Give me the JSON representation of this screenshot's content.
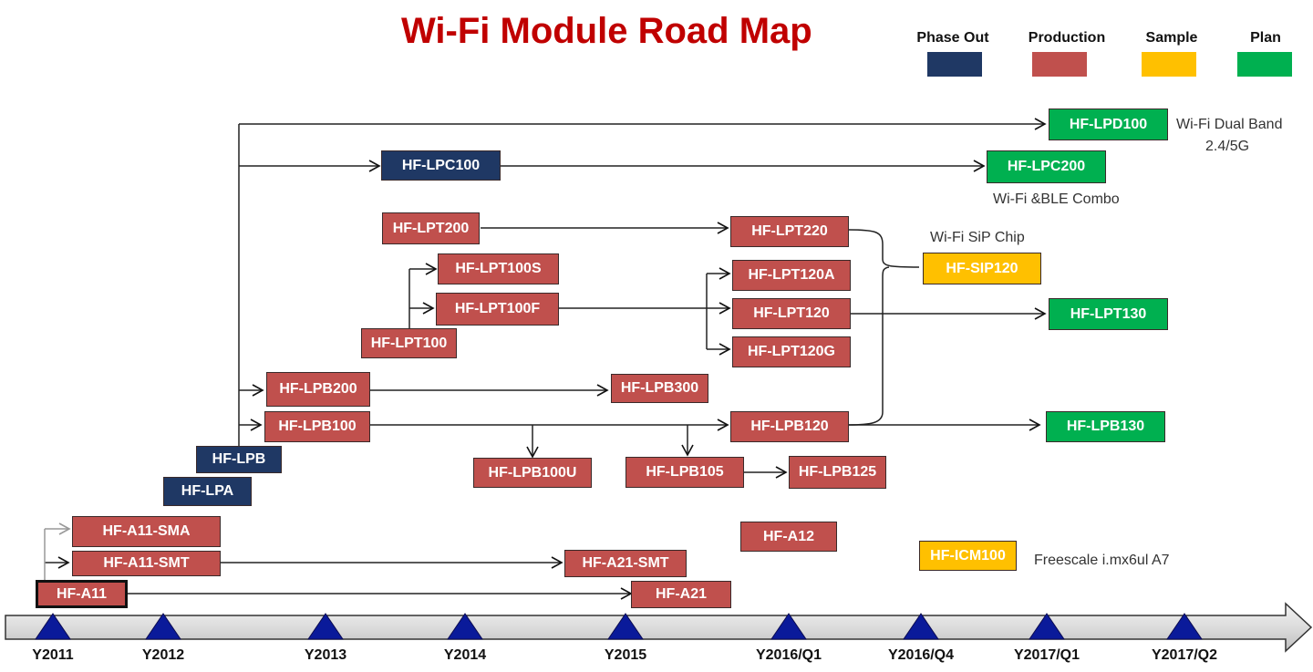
{
  "title": "Wi-Fi Module Road Map",
  "legend": [
    {
      "key": "phase_out",
      "label": "Phase Out",
      "color": "#1f3864"
    },
    {
      "key": "production",
      "label": "Production",
      "color": "#c0504d"
    },
    {
      "key": "sample",
      "label": "Sample",
      "color": "#ffc000"
    },
    {
      "key": "plan",
      "label": "Plan",
      "color": "#00b050"
    }
  ],
  "modules": [
    {
      "id": "lpd100",
      "label": "HF-LPD100",
      "status": "plan"
    },
    {
      "id": "lpc100",
      "label": "HF-LPC100",
      "status": "phase_out"
    },
    {
      "id": "lpc200",
      "label": "HF-LPC200",
      "status": "plan"
    },
    {
      "id": "lpt200",
      "label": "HF-LPT200",
      "status": "production"
    },
    {
      "id": "lpt220",
      "label": "HF-LPT220",
      "status": "production"
    },
    {
      "id": "sip120",
      "label": "HF-SIP120",
      "status": "sample"
    },
    {
      "id": "lpt100s",
      "label": "HF-LPT100S",
      "status": "production"
    },
    {
      "id": "lpt120a",
      "label": "HF-LPT120A",
      "status": "production"
    },
    {
      "id": "lpt100f",
      "label": "HF-LPT100F",
      "status": "production"
    },
    {
      "id": "lpt120",
      "label": "HF-LPT120",
      "status": "production"
    },
    {
      "id": "lpt130",
      "label": "HF-LPT130",
      "status": "plan"
    },
    {
      "id": "lpt100",
      "label": "HF-LPT100",
      "status": "production"
    },
    {
      "id": "lpt120g",
      "label": "HF-LPT120G",
      "status": "production"
    },
    {
      "id": "lpb200",
      "label": "HF-LPB200",
      "status": "production"
    },
    {
      "id": "lpb300",
      "label": "HF-LPB300",
      "status": "production"
    },
    {
      "id": "lpb100",
      "label": "HF-LPB100",
      "status": "production"
    },
    {
      "id": "lpb120",
      "label": "HF-LPB120",
      "status": "production"
    },
    {
      "id": "lpb130",
      "label": "HF-LPB130",
      "status": "plan"
    },
    {
      "id": "lpb",
      "label": "HF-LPB",
      "status": "phase_out"
    },
    {
      "id": "lpb100u",
      "label": "HF-LPB100U",
      "status": "production"
    },
    {
      "id": "lpb105",
      "label": "HF-LPB105",
      "status": "production"
    },
    {
      "id": "lpb125",
      "label": "HF-LPB125",
      "status": "production"
    },
    {
      "id": "lpa",
      "label": "HF-LPA",
      "status": "phase_out"
    },
    {
      "id": "a11sma",
      "label": "HF-A11-SMA",
      "status": "production"
    },
    {
      "id": "a12",
      "label": "HF-A12",
      "status": "production"
    },
    {
      "id": "a11smt",
      "label": "HF-A11-SMT",
      "status": "production"
    },
    {
      "id": "a21smt",
      "label": "HF-A21-SMT",
      "status": "production"
    },
    {
      "id": "icm100",
      "label": "HF-ICM100",
      "status": "sample"
    },
    {
      "id": "a11",
      "label": "HF-A11",
      "status": "production"
    },
    {
      "id": "a21",
      "label": "HF-A21",
      "status": "production"
    }
  ],
  "notes": {
    "lpd100": "Wi-Fi Dual Band",
    "lpd100_line2": "2.4/5G",
    "lpc200": "Wi-Fi &BLE Combo",
    "sip120": "Wi-Fi SiP Chip",
    "icm100": "Freescale i.mx6ul A7"
  },
  "timeline": [
    "Y2011",
    "Y2012",
    "Y2013",
    "Y2014",
    "Y2015",
    "Y2016/Q1",
    "Y2016/Q4",
    "Y2017/Q1",
    "Y2017/Q2"
  ],
  "colors": {
    "title": "#c00000",
    "marker": "#0a1a9a",
    "timeline_bar": "#d9d9d9"
  }
}
